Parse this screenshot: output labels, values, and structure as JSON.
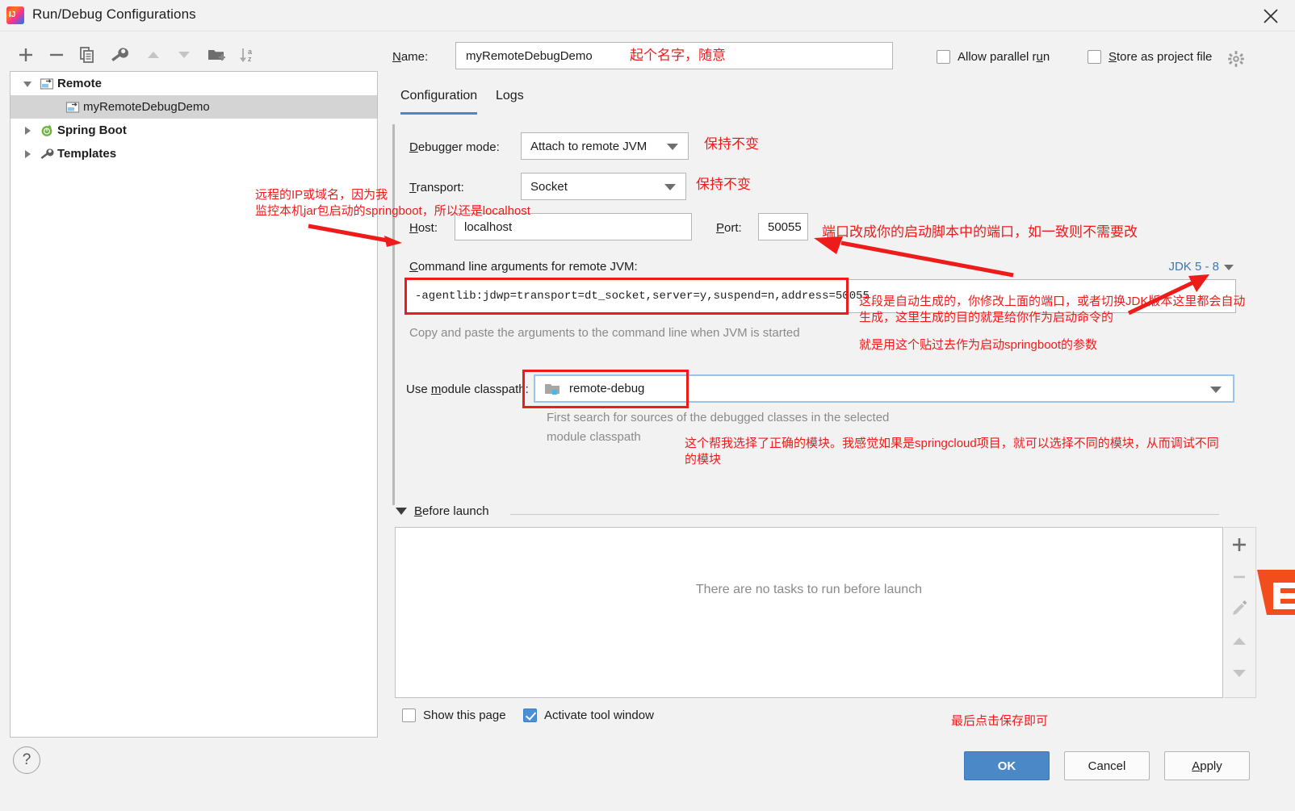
{
  "window": {
    "title": "Run/Debug Configurations",
    "logo_icon": "intellij-idea-logo",
    "close_icon": "close-icon"
  },
  "toolbar": {
    "buttons": [
      {
        "name": "add-configuration-button",
        "icon": "plus-icon"
      },
      {
        "name": "remove-configuration-button",
        "icon": "minus-icon"
      },
      {
        "name": "copy-configuration-button",
        "icon": "copy-icon"
      },
      {
        "name": "edit-templates-button",
        "icon": "wrench-icon"
      },
      {
        "name": "move-up-button",
        "icon": "arrow-up-icon"
      },
      {
        "name": "move-down-button",
        "icon": "arrow-down-icon"
      },
      {
        "name": "new-folder-button",
        "icon": "folder-add-icon"
      },
      {
        "name": "sort-alphabetically-button",
        "icon": "sort-az-icon"
      }
    ]
  },
  "tree": {
    "items": [
      {
        "label": "Remote",
        "icon": "remote-config-icon",
        "expanded": true,
        "level": 0,
        "bold": true,
        "selected": false
      },
      {
        "label": "myRemoteDebugDemo",
        "icon": "remote-config-icon",
        "level": 1,
        "bold": false,
        "selected": true
      },
      {
        "label": "Spring Boot",
        "icon": "spring-boot-icon",
        "expanded": false,
        "level": 0,
        "bold": true,
        "selected": false
      },
      {
        "label": "Templates",
        "icon": "wrench-icon",
        "expanded": false,
        "level": 0,
        "bold": true,
        "selected": false
      }
    ]
  },
  "form": {
    "name_label": "Name:",
    "name_label_mnemonic": "N",
    "name_value": "myRemoteDebugDemo",
    "allow_parallel_run": {
      "label": "Allow parallel run",
      "checked": false
    },
    "store_as_project_file": {
      "label": "Store as project file",
      "checked": false
    },
    "settings_gear_icon": "gear-icon",
    "tabs": [
      {
        "label": "Configuration",
        "active": true
      },
      {
        "label": "Logs",
        "active": false
      }
    ],
    "debugger_mode": {
      "label": "Debugger mode:",
      "mnemonic": "D",
      "value": "Attach to remote JVM"
    },
    "transport": {
      "label": "Transport:",
      "mnemonic": "T",
      "value": "Socket"
    },
    "host": {
      "label": "Host:",
      "mnemonic": "H",
      "value": "localhost"
    },
    "port": {
      "label": "Port:",
      "mnemonic": "P",
      "value": "50055"
    },
    "command_line": {
      "label": "Command line arguments for remote JVM:",
      "mnemonic": "C",
      "value": "-agentlib:jdwp=transport=dt_socket,server=y,suspend=n,address=50055",
      "hint": "Copy and paste the arguments to the command line when JVM is started"
    },
    "jdk_selector": {
      "label": "JDK 5 - 8",
      "icon": "chevron-down-icon"
    },
    "module_classpath": {
      "label": "Use module classpath:",
      "mnemonic": "m",
      "value": "remote-debug",
      "icon": "module-icon",
      "hint_line1": "First search for sources of the debugged classes in the selected",
      "hint_line2": "module classpath"
    }
  },
  "before_launch": {
    "title": "Before launch",
    "mnemonic": "B",
    "collapse_icon": "triangle-down-icon",
    "empty_text": "There are no tasks to run before launch",
    "side_buttons": [
      {
        "name": "add-task-button",
        "icon": "plus-icon",
        "enabled": true
      },
      {
        "name": "remove-task-button",
        "icon": "minus-icon",
        "enabled": false
      },
      {
        "name": "edit-task-button",
        "icon": "pencil-icon",
        "enabled": false
      },
      {
        "name": "move-task-up-button",
        "icon": "arrow-up-icon",
        "enabled": false
      },
      {
        "name": "move-task-down-button",
        "icon": "arrow-down-icon",
        "enabled": false
      }
    ],
    "show_this_page": {
      "label": "Show this page",
      "checked": false
    },
    "activate_tool_window": {
      "label": "Activate tool window",
      "checked": true
    }
  },
  "footer": {
    "help_label": "?",
    "ok_label": "OK",
    "cancel_label": "Cancel",
    "apply_label": "Apply",
    "apply_mnemonic": "A"
  },
  "annotations": {
    "name_note": "起个名字，随意",
    "debugger_mode_note": "保持不变",
    "transport_note": "保持不变",
    "host_note": "远程的IP或域名，因为我\n监控本机jar包启动的springboot，所以还是localhost",
    "port_note": "端口改成你的启动脚本中的端口，如一致则不需要改",
    "command_line_note": "这段是自动生成的，你修改上面的端口，或者切换JDK版本这里都会自动\n生成，这里生成的目的就是给你作为启动命令的",
    "paste_note": "就是用这个贴过去作为启动springboot的参数",
    "module_note": "这个帮我选择了正确的模块。我感觉如果是springcloud项目，就可以选择不同的模块，从而调试不同\n的模块",
    "save_note": "最后点击保存即可"
  },
  "colors": {
    "accent": "#4a88c7",
    "annotation_red": "#ee1b1b",
    "link_blue": "#3a76bd",
    "selection_gray": "#d4d4d4"
  }
}
